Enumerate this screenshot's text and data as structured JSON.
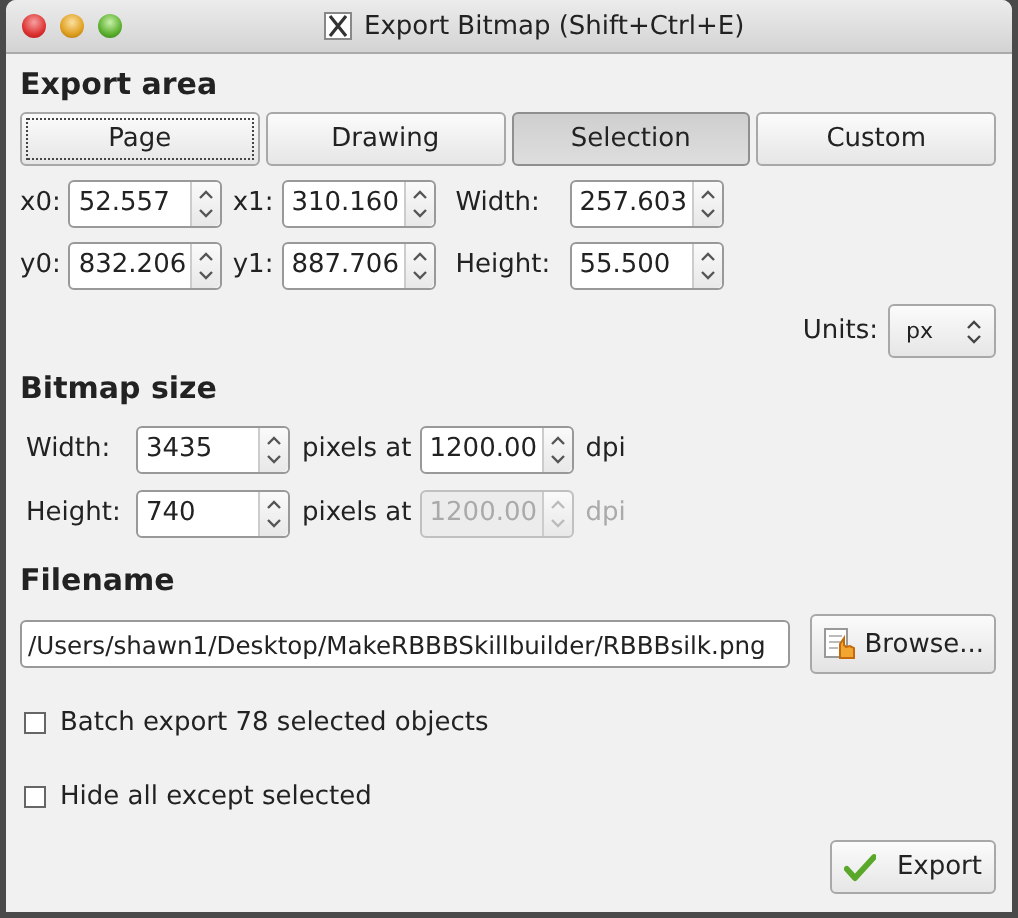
{
  "window": {
    "title": "Export Bitmap (Shift+Ctrl+E)"
  },
  "export_area": {
    "heading": "Export area",
    "tabs": [
      {
        "label": "Page",
        "selected": false,
        "focused": true
      },
      {
        "label": "Drawing",
        "selected": false,
        "focused": false
      },
      {
        "label": "Selection",
        "selected": true,
        "focused": false
      },
      {
        "label": "Custom",
        "selected": false,
        "focused": false
      }
    ],
    "rows": [
      [
        {
          "label": "x0:",
          "value": "52.557"
        },
        {
          "label": "x1:",
          "value": "310.160"
        },
        {
          "label": "Width:",
          "value": "257.603"
        }
      ],
      [
        {
          "label": "y0:",
          "value": "832.206"
        },
        {
          "label": "y1:",
          "value": "887.706"
        },
        {
          "label": "Height:",
          "value": "55.500"
        }
      ]
    ],
    "units": {
      "label": "Units:",
      "value": "px"
    }
  },
  "bitmap_size": {
    "heading": "Bitmap size",
    "rows": [
      {
        "label": "Width:",
        "value": "3435",
        "middle": "pixels at",
        "dpi_value": "1200.00",
        "unit": "dpi",
        "disabled": false
      },
      {
        "label": "Height:",
        "value": "740",
        "middle": "pixels at",
        "dpi_value": "1200.00",
        "unit": "dpi",
        "disabled": true
      }
    ]
  },
  "filename": {
    "heading": "Filename",
    "value": "/Users/shawn1/Desktop/MakeRBBBSkillbuilder/RBBBsilk.png",
    "browse": "Browse..."
  },
  "options": [
    {
      "label": "Batch export 78 selected objects",
      "checked": false
    },
    {
      "label": "Hide all except selected",
      "checked": false
    }
  ],
  "export_button": "Export"
}
